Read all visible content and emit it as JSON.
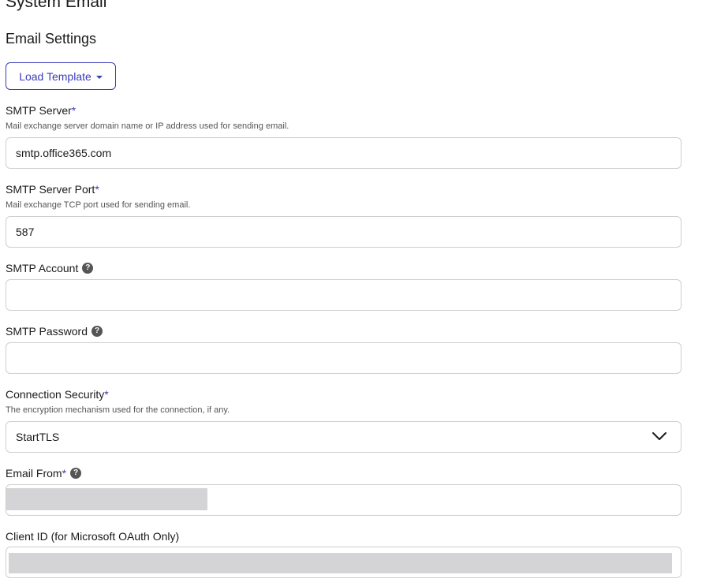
{
  "page": {
    "title": "System Email",
    "section_title": "Email Settings"
  },
  "template_button": {
    "label": "Load Template"
  },
  "fields": {
    "smtp_server": {
      "label": "SMTP Server",
      "required_mark": "*",
      "description": "Mail exchange server domain name or IP address used for sending email.",
      "value": "smtp.office365.com"
    },
    "smtp_port": {
      "label": "SMTP Server Port",
      "required_mark": "*",
      "description": "Mail exchange TCP port used for sending email.",
      "value": "587"
    },
    "smtp_account": {
      "label": "SMTP Account",
      "help_icon": "question-icon",
      "value": ""
    },
    "smtp_password": {
      "label": "SMTP Password",
      "help_icon": "question-icon",
      "value": ""
    },
    "connection_security": {
      "label": "Connection Security",
      "required_mark": "*",
      "description": "The encryption mechanism used for the connection, if any.",
      "selected": "StartTLS",
      "icon": "chevron-down-icon"
    },
    "email_from": {
      "label": "Email From",
      "required_mark": "*",
      "help_icon": "question-icon"
    },
    "client_id": {
      "label": "Client ID (for Microsoft OAuth Only)"
    }
  },
  "colors": {
    "accent": "#3b3bb8",
    "border": "#cfcfcf",
    "redaction": "#d4d4d6"
  }
}
